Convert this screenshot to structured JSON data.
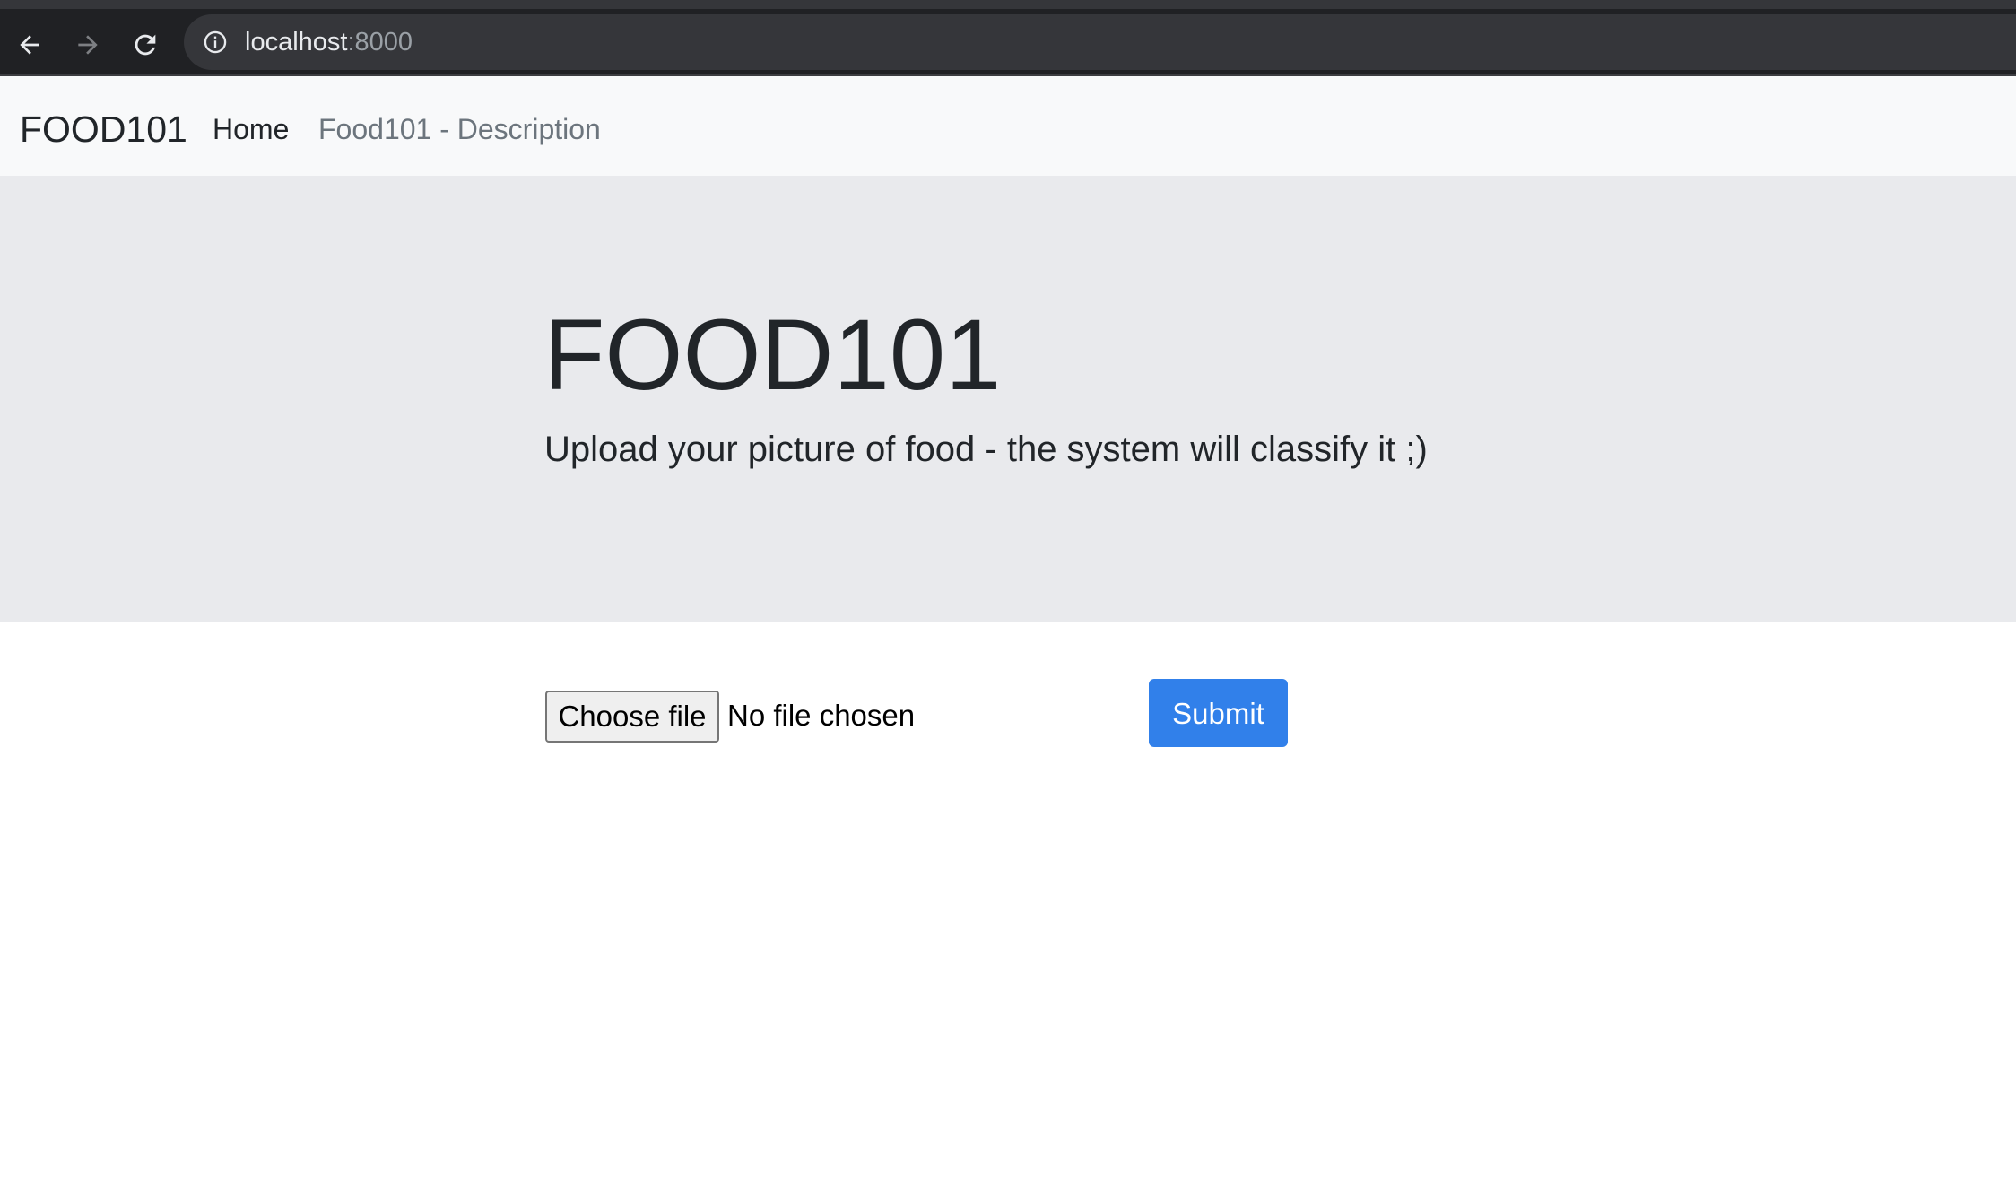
{
  "browser": {
    "url_host": "localhost",
    "url_port": ":8000",
    "icons": {
      "back": "arrow-left-icon",
      "forward": "arrow-right-icon",
      "reload": "reload-icon",
      "site_info": "info-icon"
    }
  },
  "navbar": {
    "brand": "FOOD101",
    "links": [
      {
        "label": "Home",
        "active": true
      },
      {
        "label": "Food101 - Description",
        "active": false
      }
    ]
  },
  "hero": {
    "title": "FOOD101",
    "lead": "Upload your picture of food - the system will classify it ;)"
  },
  "upload_form": {
    "file_button_label": "Choose file",
    "file_status": "No file chosen",
    "submit_label": "Submit"
  },
  "colors": {
    "browser_bar": "#202124",
    "navbar_bg": "#f8f9fa",
    "hero_bg": "#e9eaed",
    "primary": "#3180ea"
  }
}
